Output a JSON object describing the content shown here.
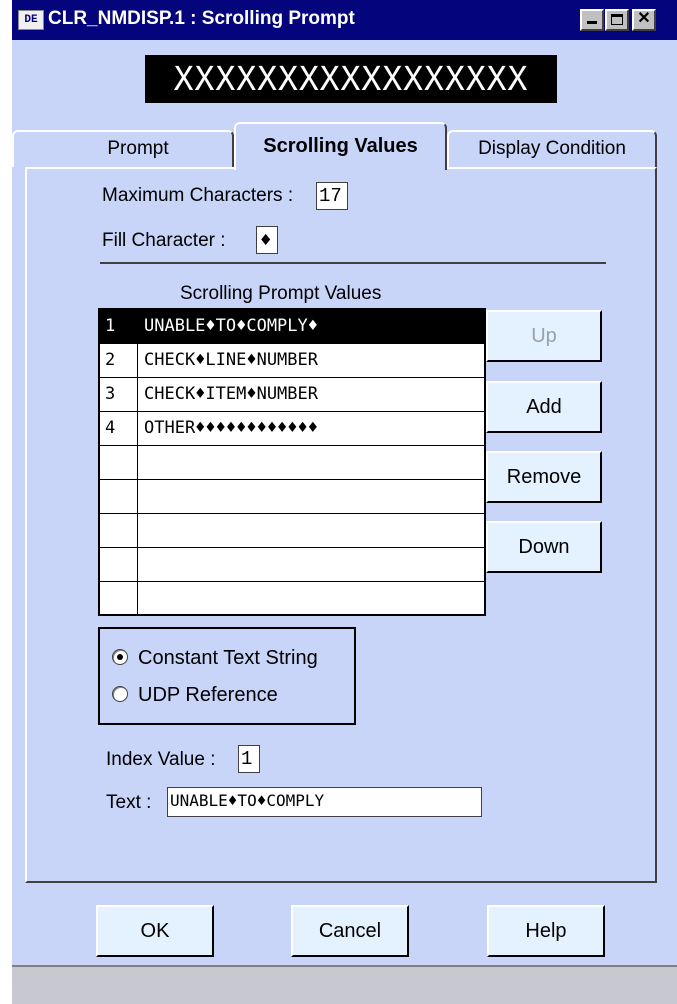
{
  "window": {
    "icon": "DE",
    "title": "CLR_NMDISP.1 : Scrolling Prompt"
  },
  "display_preview": "XXXXXXXXXXXXXXXXX",
  "tabs": [
    {
      "label": "Prompt"
    },
    {
      "label": "Scrolling Values"
    },
    {
      "label": "Display Condition"
    }
  ],
  "active_tab": "Scrolling Values",
  "max_chars": {
    "label": "Maximum Characters :",
    "value": "17"
  },
  "fill_char": {
    "label": "Fill Character :",
    "value": "♦"
  },
  "list": {
    "header": "Scrolling Prompt Values",
    "rows": [
      {
        "num": "1",
        "value": "UNABLE♦TO♦COMPLY♦"
      },
      {
        "num": "2",
        "value": "CHECK♦LINE♦NUMBER"
      },
      {
        "num": "3",
        "value": "CHECK♦ITEM♦NUMBER"
      },
      {
        "num": "4",
        "value": "OTHER♦♦♦♦♦♦♦♦♦♦♦♦"
      },
      {
        "num": "",
        "value": ""
      },
      {
        "num": "",
        "value": ""
      },
      {
        "num": "",
        "value": ""
      },
      {
        "num": "",
        "value": ""
      },
      {
        "num": "",
        "value": ""
      }
    ],
    "selected_index": 0
  },
  "side_buttons": {
    "up": "Up",
    "add": "Add",
    "remove": "Remove",
    "down": "Down"
  },
  "source": {
    "options": [
      "Constant Text String",
      "UDP Reference"
    ],
    "selected": "Constant Text String"
  },
  "index_value": {
    "label": "Index Value :",
    "value": "1"
  },
  "text_field": {
    "label": "Text :",
    "value": "UNABLE♦TO♦COMPLY"
  },
  "bottom_buttons": {
    "ok": "OK",
    "cancel": "Cancel",
    "help": "Help"
  }
}
